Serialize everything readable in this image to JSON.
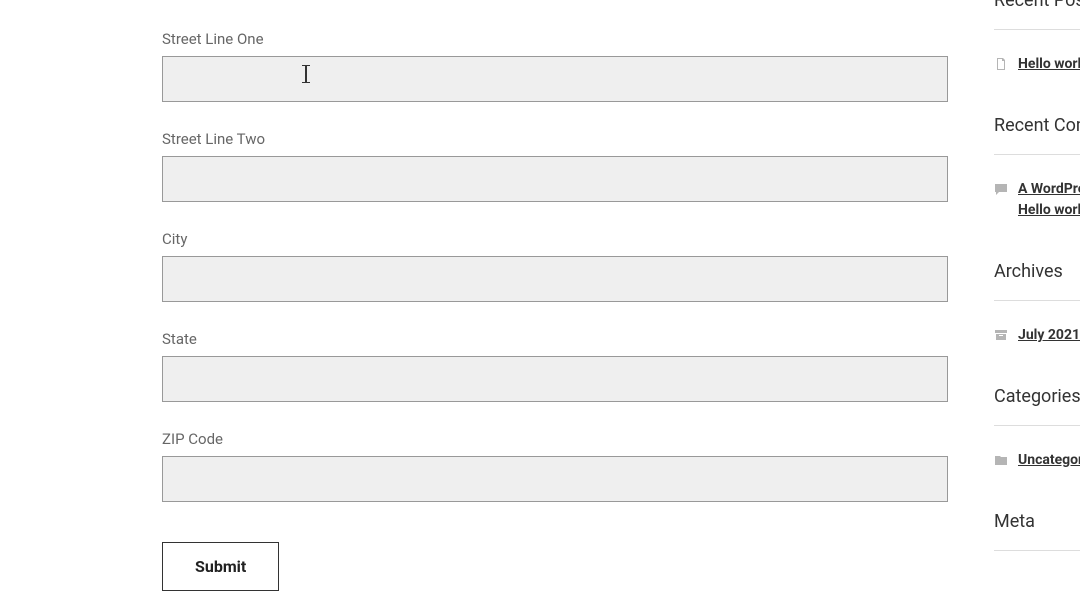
{
  "form": {
    "fields": {
      "street1": {
        "label": "Street Line One",
        "value": ""
      },
      "street2": {
        "label": "Street Line Two",
        "value": ""
      },
      "city": {
        "label": "City",
        "value": ""
      },
      "state": {
        "label": "State",
        "value": ""
      },
      "zip": {
        "label": "ZIP Code",
        "value": ""
      }
    },
    "submit_label": "Submit"
  },
  "sidebar": {
    "recent_posts": {
      "title": "Recent Posts",
      "items": [
        {
          "label": "Hello world!"
        }
      ]
    },
    "recent_comments": {
      "title": "Recent Comments",
      "items": [
        {
          "label": "A WordPress Commenter on Hello world!"
        }
      ]
    },
    "archives": {
      "title": "Archives",
      "items": [
        {
          "label": "July 2021"
        }
      ]
    },
    "categories": {
      "title": "Categories",
      "items": [
        {
          "label": "Uncategorized"
        }
      ]
    },
    "meta": {
      "title": "Meta"
    }
  }
}
